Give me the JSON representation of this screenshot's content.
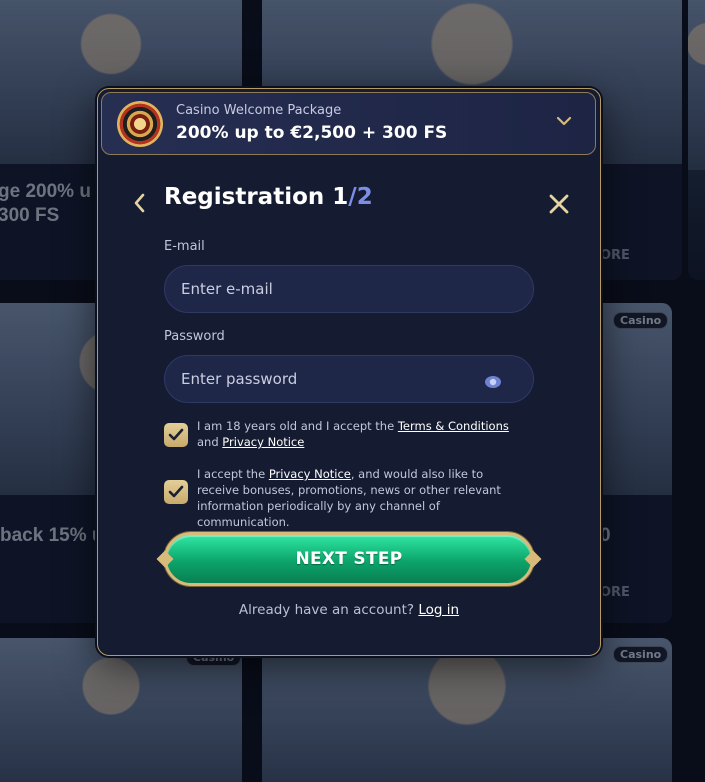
{
  "background": {
    "cards": [
      {
        "text": "ge 200% u\n300 FS",
        "more": ""
      },
      {
        "text": "",
        "more": "ORE"
      },
      {
        "text": "back 15% up",
        "more": ""
      },
      {
        "text": "0",
        "more": "ORE"
      }
    ],
    "badges": [
      "Casino",
      "Casino",
      "Casino"
    ]
  },
  "promo": {
    "label": "Casino Welcome Package",
    "value": "200% up to €2,500 + 300 FS"
  },
  "registration": {
    "title": "Registration ",
    "step_current": "1",
    "step_sep": "/",
    "step_total": "2"
  },
  "email": {
    "label": "E-mail",
    "placeholder": "Enter e-mail"
  },
  "password": {
    "label": "Password",
    "placeholder": "Enter password"
  },
  "consent": {
    "age_prefix": "I am 18 years old and I accept the ",
    "terms_link": "Terms & Conditions",
    "age_mid": " and ",
    "privacy_link_1": "Privacy Notice",
    "marketing_prefix": "I accept the ",
    "privacy_link_2": "Privacy Notice",
    "marketing_suffix": ", and would also like to receive bonuses, promotions, news or other relevant information periodically by any channel of communication."
  },
  "next_button": "NEXT STEP",
  "login": {
    "prompt": "Already have an account? ",
    "link": "Log in"
  },
  "colors": {
    "accent_gold": "#b59a63",
    "button_green": "#0ca46a",
    "step_total": "#7b8fe8",
    "modal_bg": "#151b30"
  }
}
